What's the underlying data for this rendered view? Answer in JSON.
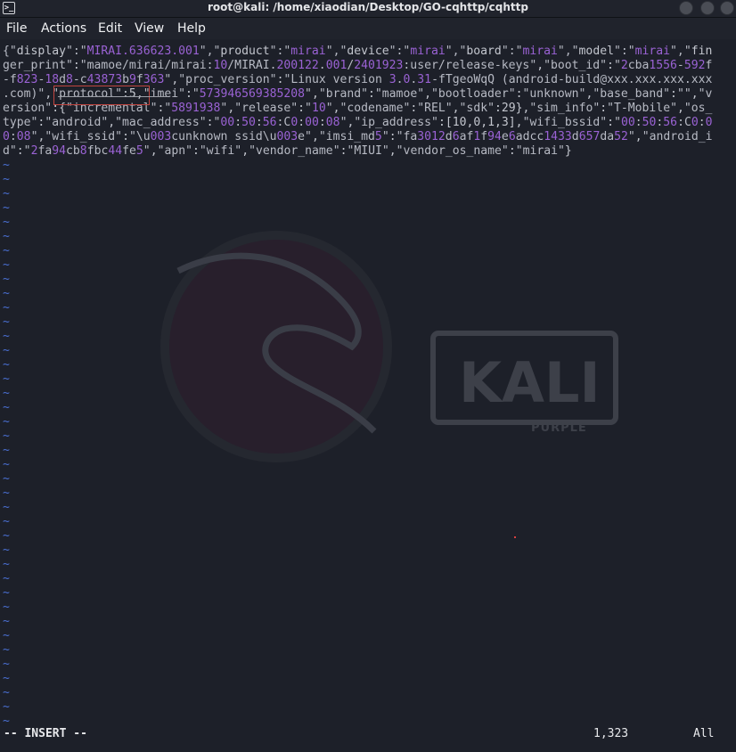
{
  "window": {
    "title": "root@kali: /home/xiaodian/Desktop/GO-cqhttp/cqhttp"
  },
  "menu": [
    "File",
    "Actions",
    "Edit",
    "View",
    "Help"
  ],
  "editor": {
    "lines": [
      "{\"display\":\"MIRAI.636623.001\",\"product\":\"mirai\",\"device\":\"mirai\",\"board\":\"mirai\",\"model\":\"mirai\",\"fin",
      "ger_print\":\"mamoe/mirai/mirai:10/MIRAI.200122.001/2401923:user/release-keys\",\"boot_id\":\"2cba1556-592f",
      "-f823-18d8-c43873b9f363\",\"proc_version\":\"Linux version 3.0.31-fTgeoWqQ (android-build@xxx.xxx.xxx.xxx",
      ".com)\",\"protocol\":5,\"imei\":\"573946569385208\",\"brand\":\"mamoe\",\"bootloader\":\"unknown\",\"base_band\":\"\",\"v",
      "ersion\":{\"incremental\":\"5891938\",\"release\":\"10\",\"codename\":\"REL\",\"sdk\":29},\"sim_info\":\"T-Mobile\",\"os_",
      "type\":\"android\",\"mac_address\":\"00:50:56:C0:00:08\",\"ip_address\":[10,0,1,3],\"wifi_bssid\":\"00:50:56:C0:0",
      "0:08\",\"wifi_ssid\":\"\\u003cunknown ssid\\u003e\",\"imsi_md5\":\"fa3012d6af1f94e6adcc1433d657da52\",\"android_i",
      "d\":\"2fa94cb8fbc44fe5\",\"apn\":\"wifi\",\"vendor_name\":\"MIUI\",\"vendor_os_name\":\"mirai\"}"
    ],
    "tilde_count": 40,
    "tilde_char": "~"
  },
  "status": {
    "mode": "-- INSERT --",
    "position": "1,323",
    "scroll": "All"
  },
  "wallpaper": {
    "brand": "KALI",
    "edition": "PURPLE"
  },
  "colors": {
    "background": "#1d2029",
    "string": "#9a62d4",
    "tilde": "#4a6fd1",
    "highlight_box": "#c2453f"
  }
}
